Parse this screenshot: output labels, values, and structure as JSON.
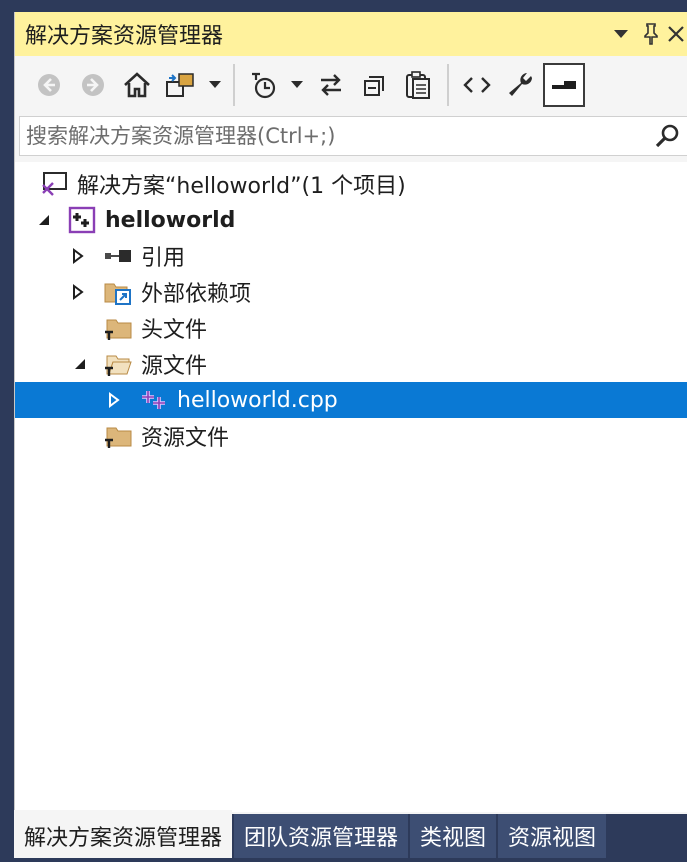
{
  "window": {
    "title": "解决方案资源管理器",
    "dropdown_icon": "dropdown-arrow-icon",
    "pin_icon": "pin-icon",
    "close_icon": "close-icon"
  },
  "toolbar": {
    "buttons": [
      "back-icon",
      "forward-icon",
      "home-icon",
      "switch-views-icon",
      "dropdown-arrow-icon",
      "pending-changes-filter-icon",
      "dropdown-arrow-icon",
      "sync-icon",
      "collapse-all-icon",
      "show-all-files-icon",
      "view-code-icon",
      "properties-wrench-icon",
      "preview-selected-icon"
    ]
  },
  "search": {
    "placeholder": "搜索解决方案资源管理器(Ctrl+;)",
    "icon": "search-icon"
  },
  "tree": {
    "solution": "解决方案“helloworld”(1 个项目)",
    "project": "helloworld",
    "references": "引用",
    "external_dependencies": "外部依赖项",
    "header_files": "头文件",
    "source_files": "源文件",
    "cpp_file": "helloworld.cpp",
    "resource_files": "资源文件"
  },
  "tabs": [
    "解决方案资源管理器",
    "团队资源管理器",
    "类视图",
    "资源视图"
  ],
  "colors": {
    "title_bar": "#fff29d",
    "selection": "#0a79d4",
    "tab_inactive": "#3d4e73",
    "frame": "#2d3a5a"
  }
}
